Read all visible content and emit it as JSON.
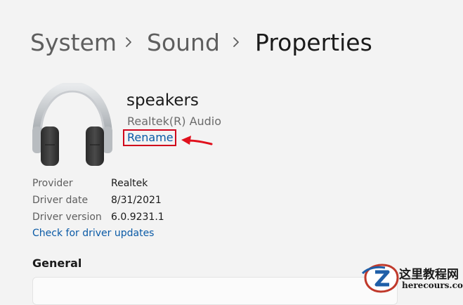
{
  "breadcrumb": {
    "items": [
      "System",
      "Sound"
    ],
    "current": "Properties"
  },
  "device": {
    "name": "speakers",
    "driver": "Realtek(R) Audio",
    "rename_label": "Rename",
    "icon": "headphones-icon"
  },
  "properties": [
    {
      "label": "Provider",
      "value": "Realtek"
    },
    {
      "label": "Driver date",
      "value": "8/31/2021"
    },
    {
      "label": "Driver version",
      "value": "6.0.9231.1"
    }
  ],
  "driver_update_link": "Check for driver updates",
  "sections": {
    "general": "General"
  },
  "watermark": {
    "title": "这里教程网",
    "site": "herecours.com"
  },
  "colors": {
    "accent_link": "#0a5aa6",
    "annotation_red": "#d0021b",
    "background": "#f3f3f3"
  }
}
